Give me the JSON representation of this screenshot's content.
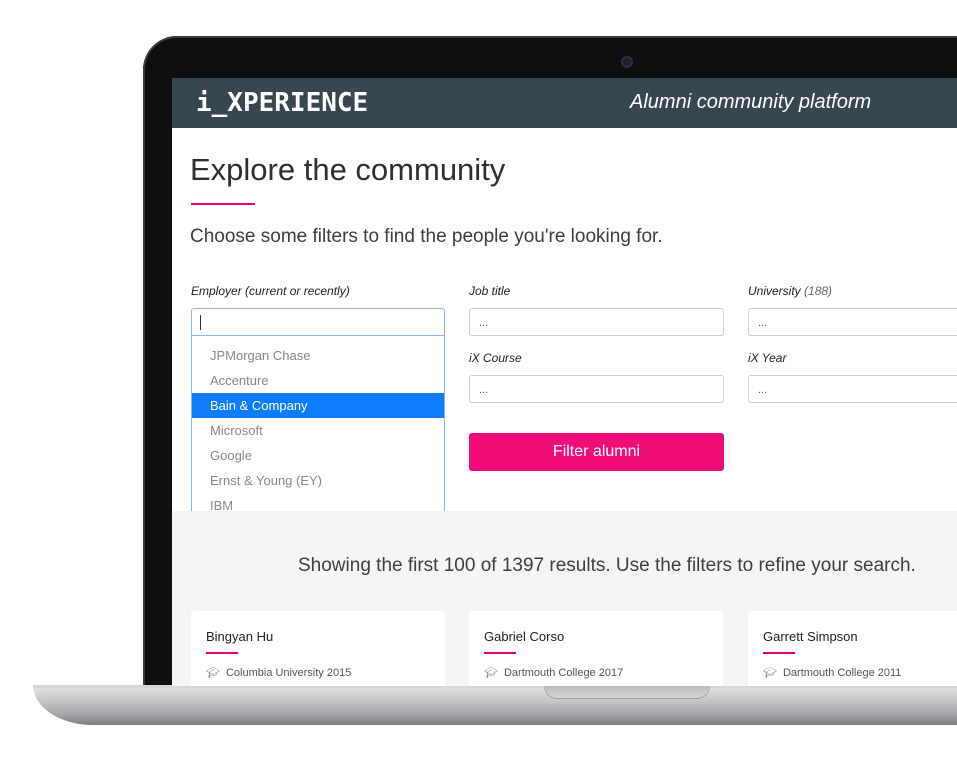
{
  "header": {
    "logo": "i_XPERIENCE",
    "tagline": "Alumni community platform"
  },
  "page": {
    "title": "Explore the community",
    "subtitle": "Choose some filters to find the people you're looking for."
  },
  "filters": {
    "employer": {
      "label": "Employer (current or recently)",
      "value": "",
      "options": [
        "JPMorgan Chase",
        "Accenture",
        "Bain & Company",
        "Microsoft",
        "Google",
        "Ernst & Young (EY)",
        "IBM"
      ],
      "highlighted": "Bain & Company"
    },
    "job_title": {
      "label": "Job title",
      "placeholder": "..."
    },
    "university": {
      "label": "University",
      "count": "(188)",
      "placeholder": "..."
    },
    "ix_course": {
      "label": "iX Course",
      "placeholder": "..."
    },
    "ix_year": {
      "label": "iX Year",
      "placeholder": "..."
    },
    "submit_label": "Filter alumni"
  },
  "results": {
    "summary": "Showing the first 100 of 1397 results. Use the filters to refine your search.",
    "cards": [
      {
        "name": "Bingyan Hu",
        "school": "Columbia University 2015"
      },
      {
        "name": "Gabriel Corso",
        "school": "Dartmouth College 2017"
      },
      {
        "name": "Garrett Simpson",
        "school": "Dartmouth College 2011"
      }
    ]
  },
  "colors": {
    "topbar": "#37474f",
    "accent": "#e6006d",
    "button": "#f10d78",
    "selected_option": "#0d7dfb"
  },
  "icons": {
    "school": "graduation-cap-icon"
  }
}
